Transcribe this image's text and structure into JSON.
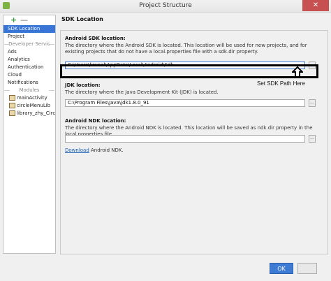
{
  "window": {
    "title": "Project Structure",
    "close_glyph": "✕"
  },
  "left_panel": {
    "add_glyph": "+",
    "remove_glyph": "—",
    "items": [
      {
        "label": "SDK Location",
        "selected": true
      },
      {
        "label": "Project",
        "selected": false
      }
    ],
    "developer_services_header": "Developer Servic",
    "services": [
      "Ads",
      "Analytics",
      "Authentication",
      "Cloud",
      "Notifications"
    ],
    "modules_header": "Modules",
    "modules": [
      "mainActivity",
      "circleMenuLib",
      "library_zhy_Circle"
    ]
  },
  "main": {
    "section_title": "SDK Location",
    "android_sdk": {
      "label": "Android SDK location:",
      "description": "The directory where the Android SDK is located. This location will be used for new projects, and for existing projects that do not have a local.properties file with a sdk.dir property.",
      "value": "C:\\Users\\krunal\\AppData\\Local\\Android\\Sdk"
    },
    "annotation": "Set SDK Path Here",
    "jdk": {
      "label": "JDK location:",
      "description": "The directory where the Java Development Kit (JDK) is located.",
      "value": "C:\\Program Files\\Java\\jdk1.8.0_91"
    },
    "ndk": {
      "label": "Android NDK location:",
      "description": "The directory where the Android NDK is located. This location will be saved as ndk.dir property in the local.properties file.",
      "value": "",
      "download_link": "Download",
      "download_suffix": " Android NDK."
    },
    "browse_glyph": "..."
  },
  "footer": {
    "ok_label": "OK",
    "cancel_label": ""
  }
}
